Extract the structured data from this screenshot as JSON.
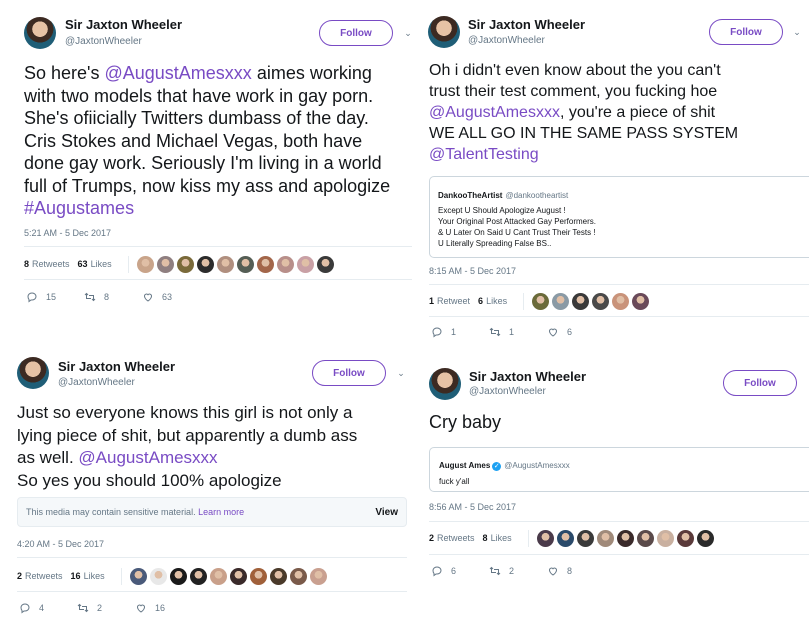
{
  "tweets": [
    {
      "name": "Sir Jaxton Wheeler",
      "handle": "@JaxtonWheeler",
      "follow_label": "Follow",
      "lines": [
        {
          "parts": [
            {
              "t": "So here's "
            },
            {
              "t": "@AugustAmesxxx",
              "link": true
            },
            {
              "t": " aimes working"
            }
          ]
        },
        {
          "parts": [
            {
              "t": "with two models that have work in gay porn."
            }
          ]
        },
        {
          "parts": [
            {
              "t": "She's ofiicially Twitters dumbass of the day."
            }
          ]
        },
        {
          "parts": [
            {
              "t": "Cris Stokes and Michael Vegas, both have"
            }
          ]
        },
        {
          "parts": [
            {
              "t": "done gay work. Seriously I'm living in a world"
            }
          ]
        },
        {
          "parts": [
            {
              "t": "full of Trumps, now kiss my ass and apologize"
            }
          ]
        },
        {
          "parts": [
            {
              "t": "#Augustames",
              "link": true
            }
          ]
        }
      ],
      "timestamp": "5:21 AM - 5 Dec 2017",
      "retweets": {
        "count": "8",
        "label": "Retweets"
      },
      "likes": {
        "count": "63",
        "label": "Likes"
      },
      "liker_colors": [
        "#c9a48a",
        "#8f7f80",
        "#7a6a3a",
        "#2c2c2c",
        "#b08f7f",
        "#555e55",
        "#a3664a",
        "#b88f8a",
        "#c9a0a5",
        "#3a3a3a"
      ],
      "actions": {
        "replies": "15",
        "retweets": "8",
        "likes": "63"
      }
    },
    {
      "name": "Sir Jaxton Wheeler",
      "handle": "@JaxtonWheeler",
      "follow_label": "Follow",
      "lines": [
        {
          "parts": [
            {
              "t": "Oh i didn't even know about the you can't"
            }
          ]
        },
        {
          "parts": [
            {
              "t": "trust their test comment, you fucking hoe"
            }
          ]
        },
        {
          "parts": [
            {
              "t": "@AugustAmesxxx",
              "link": true
            },
            {
              "t": ", you're a piece of shit"
            }
          ]
        },
        {
          "parts": [
            {
              "t": "WE ALL GO IN THE SAME PASS SYSTEM"
            }
          ]
        },
        {
          "parts": [
            {
              "t": "@TalentTesting",
              "link": true
            }
          ]
        }
      ],
      "quote": {
        "name": "DankooTheArtist",
        "handle": "@dankootheartist",
        "lines": [
          "Except U Should Apologize August !",
          "Your Original Post Attacked Gay Performers.",
          "& U Later On Said U Cant Trust Their Tests !",
          "U Literally Spreading False BS.."
        ]
      },
      "timestamp": "8:15 AM - 5 Dec 2017",
      "retweets": {
        "count": "1",
        "label": "Retweet"
      },
      "likes": {
        "count": "6",
        "label": "Likes"
      },
      "liker_colors": [
        "#6b6b3a",
        "#8a9aa5",
        "#3a3a3a",
        "#4a4a4a",
        "#c9937a",
        "#6a4a5a"
      ],
      "actions": {
        "replies": "1",
        "retweets": "1",
        "likes": "6"
      }
    },
    {
      "name": "Sir Jaxton Wheeler",
      "handle": "@JaxtonWheeler",
      "follow_label": "Follow",
      "lines": [
        {
          "parts": [
            {
              "t": "Just so everyone knows this girl is not only a"
            }
          ]
        },
        {
          "parts": [
            {
              "t": "lying piece of shit, but apparently a dumb ass"
            }
          ]
        },
        {
          "parts": [
            {
              "t": "as well. "
            },
            {
              "t": "@AugustAmesxxx",
              "link": true
            }
          ]
        },
        {
          "parts": [
            {
              "t": "So yes you should 100% apologize"
            }
          ]
        }
      ],
      "sensitive": {
        "text": "This media may contain sensitive material.",
        "learn": "Learn more",
        "view": "View"
      },
      "timestamp": "4:20 AM - 5 Dec 2017",
      "retweets": {
        "count": "2",
        "label": "Retweets"
      },
      "likes": {
        "count": "16",
        "label": "Likes"
      },
      "liker_colors": [
        "#4a5a7a",
        "#e8e8e8",
        "#1a1a1a",
        "#222222",
        "#c9a08a",
        "#3a2a2a",
        "#a0603a",
        "#4a3a2a",
        "#7a5a4a",
        "#c9a090"
      ],
      "actions": {
        "replies": "4",
        "retweets": "2",
        "likes": "16"
      }
    },
    {
      "name": "Sir Jaxton Wheeler",
      "handle": "@JaxtonWheeler",
      "follow_label": "Follow",
      "lines": [
        {
          "parts": [
            {
              "t": "Cry baby"
            }
          ]
        }
      ],
      "quote": {
        "name": "August Ames",
        "handle": "@AugustAmesxxx",
        "verified": true,
        "lines": [
          "fuck y'all"
        ]
      },
      "timestamp": "8:56 AM - 5 Dec 2017",
      "retweets": {
        "count": "2",
        "label": "Retweets"
      },
      "likes": {
        "count": "8",
        "label": "Likes"
      },
      "liker_colors": [
        "#4a3a4a",
        "#2a4a6a",
        "#3a3a3a",
        "#a08a7a",
        "#3a2a2a",
        "#5a4a4a",
        "#c9b0a0",
        "#5a3a3a",
        "#2a2a2a"
      ],
      "actions": {
        "replies": "6",
        "retweets": "2",
        "likes": "8"
      }
    }
  ]
}
